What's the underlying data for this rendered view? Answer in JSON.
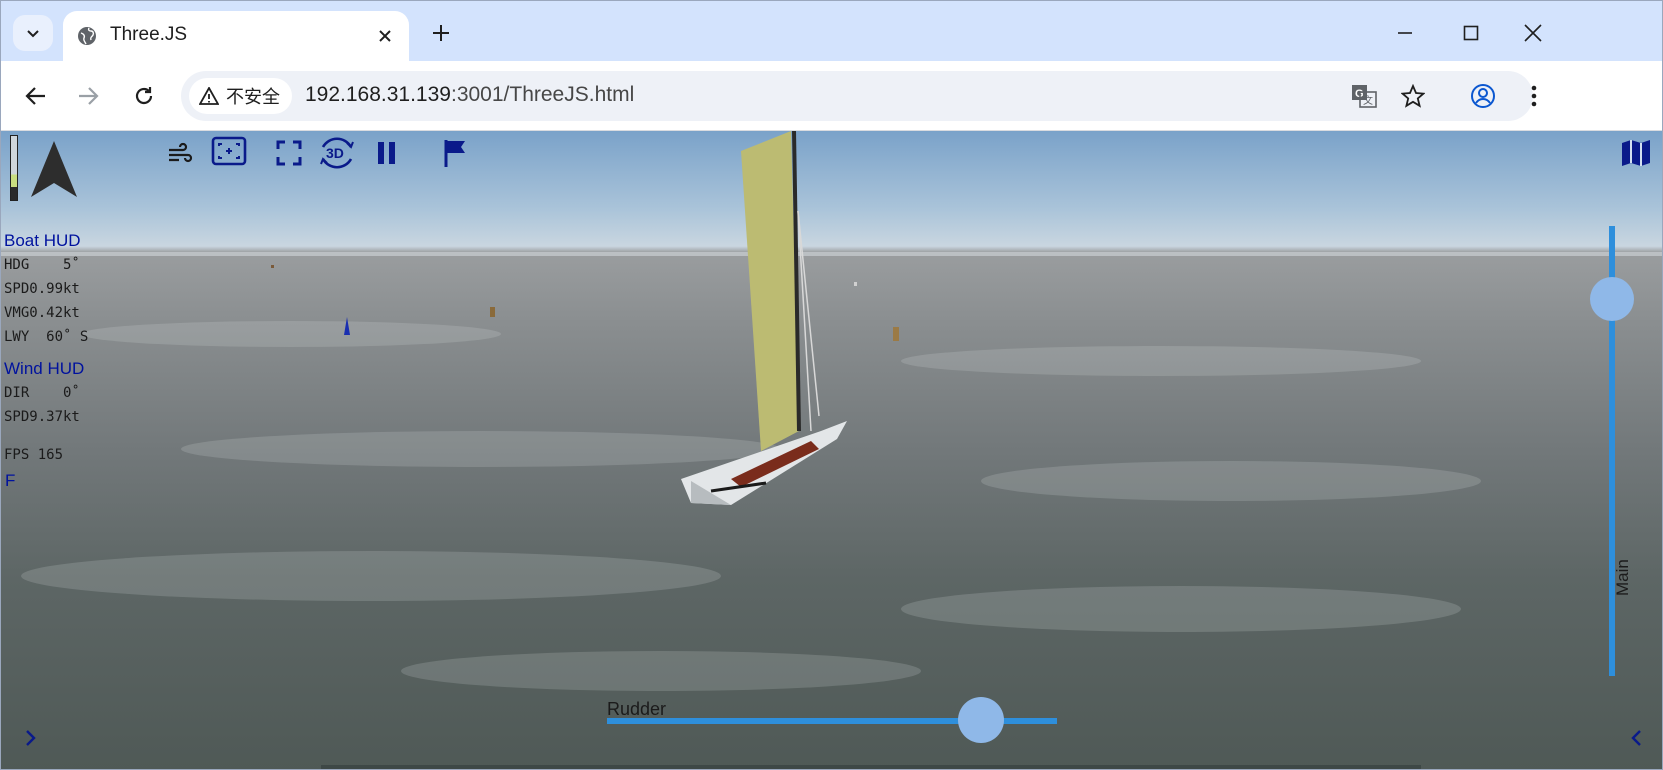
{
  "browser": {
    "tab_title": "Three.JS",
    "address": {
      "security_label": "不安全",
      "url_host": "192.168.31.139",
      "url_rest": ":3001/ThreeJS.html"
    }
  },
  "hud": {
    "boat_title": "Boat HUD",
    "boat_rows": [
      "HDG    5˚",
      "SPD0.99kt",
      "VMG0.42kt",
      "LWY  60˚ S"
    ],
    "wind_title": "Wind HUD",
    "wind_rows": [
      "DIR    0˚",
      "SPD9.37kt"
    ],
    "fps_row": "FPS 165",
    "flag": "F"
  },
  "controls": {
    "main_label": "Main",
    "main_level_fraction": 0.14,
    "rudder_label": "Rudder",
    "rudder_fraction": 0.83
  },
  "colors": {
    "accent": "#2e8fdc",
    "thumb": "#8fb8e8",
    "hud_title": "#00129e",
    "sail": "#bcbb72"
  },
  "icons": {
    "toolbar": [
      "wind-icon",
      "fit-view-icon",
      "fullscreen-icon",
      "3d-rotate-icon",
      "pause-icon",
      "flag-icon"
    ],
    "top_right": "map-icon",
    "compass": "north-arrow-icon"
  }
}
